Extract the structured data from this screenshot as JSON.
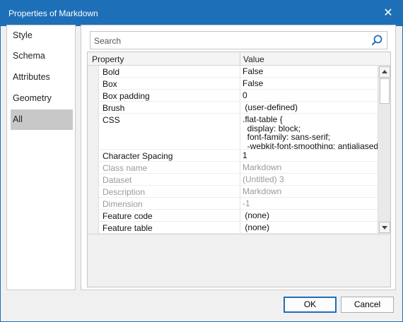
{
  "window": {
    "title": "Properties of Markdown",
    "accent": "#1d6fb8"
  },
  "sidebar": {
    "items": [
      {
        "label": "Style"
      },
      {
        "label": "Schema"
      },
      {
        "label": "Attributes"
      },
      {
        "label": "Geometry"
      },
      {
        "label": "All",
        "selected": true
      }
    ]
  },
  "search": {
    "placeholder": "Search",
    "value": ""
  },
  "grid": {
    "columns": {
      "property": "Property",
      "value": "Value"
    },
    "rows": [
      {
        "name": "Bold",
        "value": "False",
        "enabled": true
      },
      {
        "name": "Box",
        "value": "False",
        "enabled": true
      },
      {
        "name": "Box padding",
        "value": "0",
        "enabled": true
      },
      {
        "name": "Brush",
        "value": " (user-defined)",
        "enabled": true
      },
      {
        "name": "CSS",
        "value": ".flat-table {\n  display: block;\n  font-family: sans-serif;\n  -webkit-font-smoothing: antialiased;",
        "enabled": true
      },
      {
        "name": "Character Spacing",
        "value": "1",
        "enabled": true
      },
      {
        "name": "Class name",
        "value": "Markdown",
        "enabled": false
      },
      {
        "name": "Dataset",
        "value": "(Untitled) 3",
        "enabled": false
      },
      {
        "name": "Description",
        "value": "Markdown",
        "enabled": false
      },
      {
        "name": "Dimension",
        "value": "-1",
        "enabled": false
      },
      {
        "name": "Feature code",
        "value": " (none)",
        "enabled": true
      },
      {
        "name": "Feature table",
        "value": " (none)",
        "enabled": true
      }
    ]
  },
  "buttons": {
    "ok": "OK",
    "cancel": "Cancel"
  }
}
